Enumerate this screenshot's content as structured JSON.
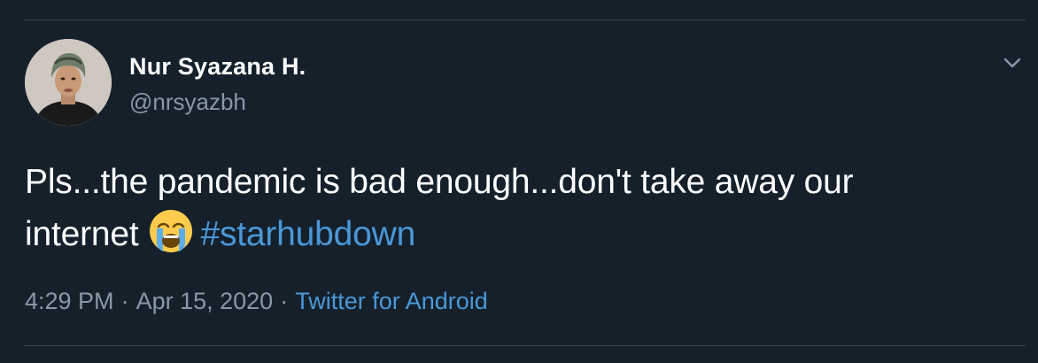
{
  "tweet": {
    "author": {
      "display_name": "Nur Syazana H.",
      "username": "@nrsyazbh"
    },
    "text": {
      "line1": "Pls...the pandemic is bad enough...don't take away our",
      "line2_prefix": "internet",
      "emoji": "loudly-crying-face",
      "hashtag": "#starhubdown"
    },
    "meta": {
      "time": "4:29 PM",
      "separator": "·",
      "date": "Apr 15, 2020",
      "source": "Twitter for Android"
    }
  },
  "colors": {
    "background": "#15202b",
    "text": "#ffffff",
    "secondary_text": "#8899a6",
    "link": "#4a98d8",
    "divider": "#38444d"
  },
  "icons": {
    "caret": "chevron-down-icon",
    "emoji": "loudly-crying-face-emoji"
  }
}
